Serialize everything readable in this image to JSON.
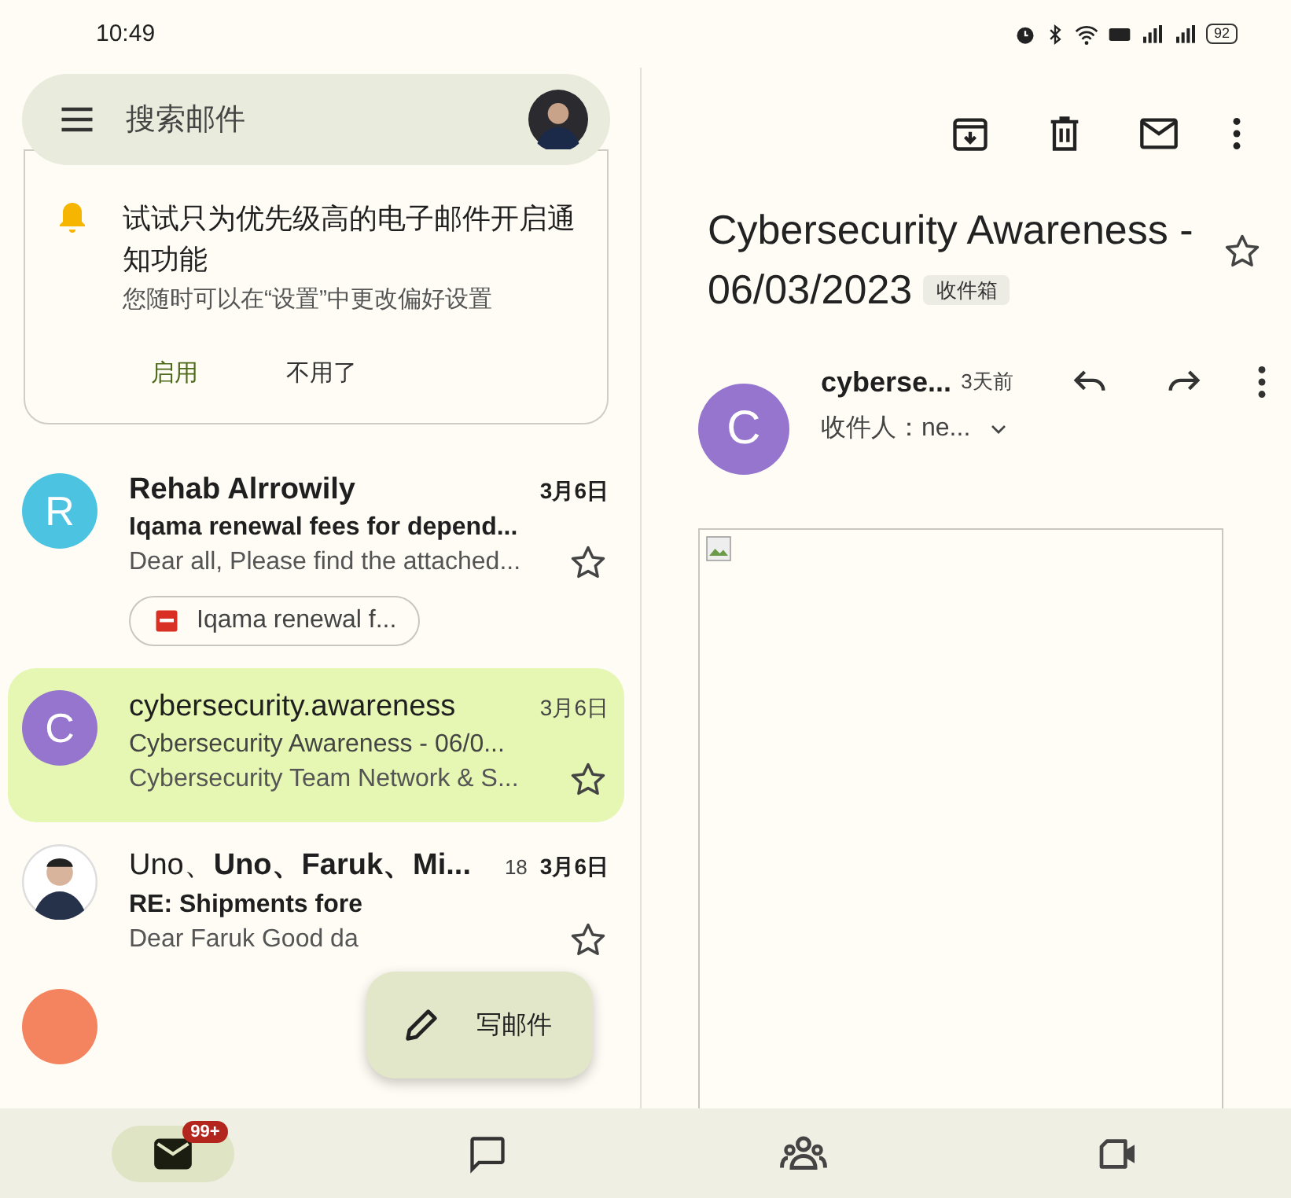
{
  "status_bar": {
    "time": "10:49",
    "battery": "92"
  },
  "search": {
    "placeholder": "搜索邮件"
  },
  "notice": {
    "title": "试试只为优先级高的电子邮件开启通知功能",
    "text": "您随时可以在“设置”中更改偏好设置",
    "buttons": [
      {
        "label": "启用",
        "kind": "primary"
      },
      {
        "label": "不用了",
        "kind": "plain"
      }
    ]
  },
  "emails": [
    {
      "avatar": {
        "kind": "letter",
        "letter": "R",
        "color": "#4cc3e0"
      },
      "senders": [
        {
          "name": "Rehab Alrrowily",
          "unread": true
        }
      ],
      "date": "3月6日",
      "subject": "Iqama renewal fees for depend...",
      "preview": "Dear all, Please find the attached...",
      "unread": true,
      "selected": false,
      "starred": false,
      "attachment": "Iqama renewal f..."
    },
    {
      "avatar": {
        "kind": "letter",
        "letter": "C",
        "color": "#9575cd"
      },
      "senders": [
        {
          "name": "cybersecurity.awareness",
          "unread": false
        }
      ],
      "date": "3月6日",
      "subject": "Cybersecurity Awareness - 06/0...",
      "preview": "Cybersecurity Team Network & S...",
      "unread": false,
      "selected": true,
      "starred": false
    },
    {
      "avatar": {
        "kind": "photo"
      },
      "senders": [
        {
          "name": "Uno、",
          "unread": false
        },
        {
          "name": "Uno、",
          "unread": true
        },
        {
          "name": "Faruk、",
          "unread": true
        },
        {
          "name": "Mi...",
          "unread": true
        }
      ],
      "count": "18",
      "date": "3月6日",
      "subject": "RE: Shipments fore",
      "preview": "Dear Faruk Good da",
      "unread": true,
      "selected": false,
      "starred": false
    },
    {
      "avatar": {
        "kind": "partial",
        "color": "#f4845f"
      }
    }
  ],
  "compose": {
    "label": "写邮件"
  },
  "message": {
    "title": "Cybersecurity Awareness - 06/03/2023",
    "label": "收件箱",
    "starred": false,
    "avatar_letter": "C",
    "sender": "cyberse...",
    "time": "3天前",
    "to": "收件人：ne..."
  },
  "nav": [
    {
      "kind": "mail",
      "selected": true,
      "badge": "99+"
    },
    {
      "kind": "chat",
      "selected": false
    },
    {
      "kind": "spaces",
      "selected": false
    },
    {
      "kind": "meet",
      "selected": false
    }
  ]
}
